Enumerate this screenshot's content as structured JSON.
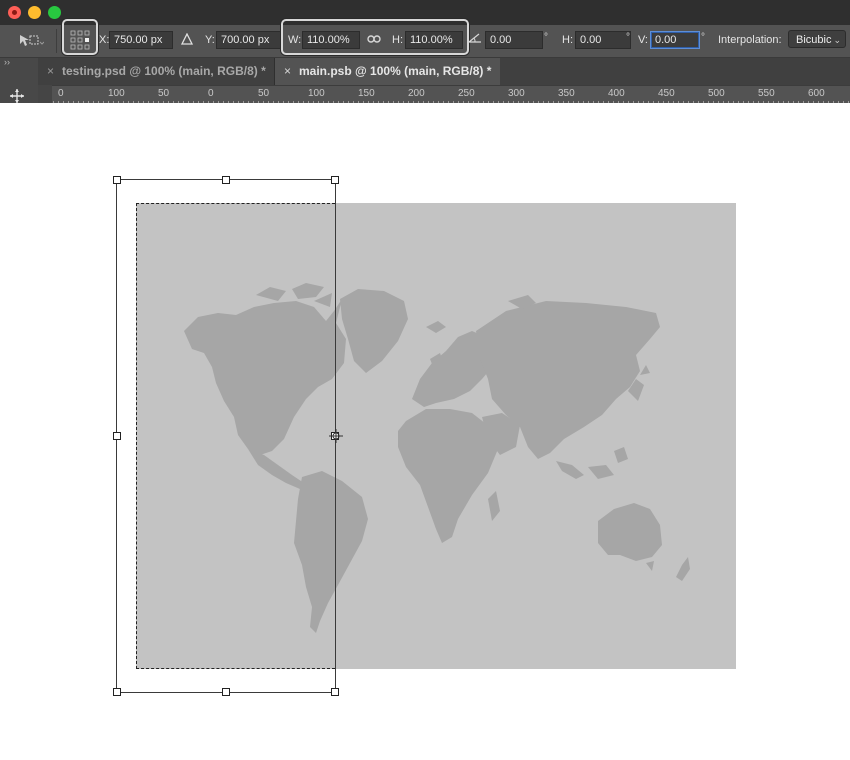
{
  "window": {
    "tabs": [
      {
        "label": "testing.psd @ 100% (main, RGB/8) *",
        "close": "×"
      },
      {
        "label": "main.psb @ 100% (main, RGB/8) *",
        "close": "×"
      }
    ]
  },
  "options_bar": {
    "x_label": "X:",
    "x_value": "750.00 px",
    "y_label": "Y:",
    "y_value": "700.00 px",
    "w_label": "W:",
    "w_value": "110.00%",
    "h_label": "H:",
    "h_value": "110.00%",
    "rotate_value": "0.00",
    "rotate_unit": "°",
    "hskew_label": "H:",
    "hskew_value": "0.00",
    "hskew_unit": "°",
    "vskew_label": "V:",
    "vskew_value": "0.00",
    "vskew_unit": "°",
    "interpolation_label": "Interpolation:",
    "interpolation_value": "Bicubic"
  },
  "ruler": {
    "labels": [
      "0",
      "100",
      "50",
      "0",
      "50",
      "100",
      "150",
      "200",
      "250",
      "300",
      "350",
      "400",
      "450",
      "500",
      "550",
      "600"
    ]
  },
  "colors": {
    "map_background": "#c3c3c3",
    "continents": "#a6a6a6",
    "panel": "#535353"
  },
  "icons": {
    "transform_tool": "transform-move-icon",
    "reference_point": "reference-point-grid-icon",
    "delta": "delta-triangle-icon",
    "link": "chain-link-icon",
    "rotate": "angle-icon",
    "move_cursor": "move-arrows-icon"
  }
}
